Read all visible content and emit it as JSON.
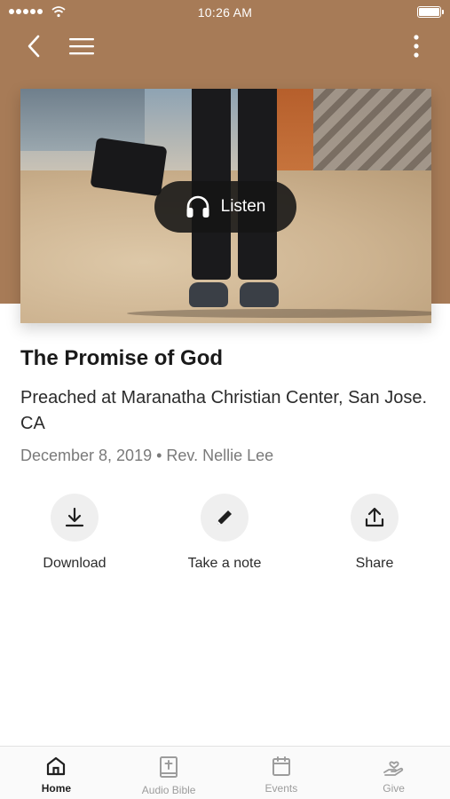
{
  "status_bar": {
    "time": "10:26 AM"
  },
  "nav": {
    "back_icon": "chevron-left-icon",
    "menu_icon": "hamburger-icon",
    "more_icon": "vertical-dots-icon"
  },
  "hero": {
    "listen_label": "Listen",
    "listen_icon": "headphones-icon"
  },
  "sermon": {
    "title": "The Promise of God",
    "subtitle": "Preached at Maranatha Christian Center, San Jose. CA",
    "meta": "December 8, 2019 • Rev. Nellie Lee"
  },
  "actions": [
    {
      "label": "Download",
      "icon": "download-icon"
    },
    {
      "label": "Take a note",
      "icon": "pencil-icon"
    },
    {
      "label": "Share",
      "icon": "share-icon"
    }
  ],
  "tabs": [
    {
      "label": "Home",
      "icon": "home-icon",
      "active": true
    },
    {
      "label": "Audio Bible",
      "icon": "bible-icon",
      "active": false
    },
    {
      "label": "Events",
      "icon": "calendar-icon",
      "active": false
    },
    {
      "label": "Give",
      "icon": "give-hand-icon",
      "active": false
    }
  ],
  "colors": {
    "header_brown": "#a77b57",
    "listen_bg": "#141414",
    "action_circle": "#efefef",
    "tab_active": "#1f1f1f",
    "tab_inactive": "#9c9c9c"
  }
}
